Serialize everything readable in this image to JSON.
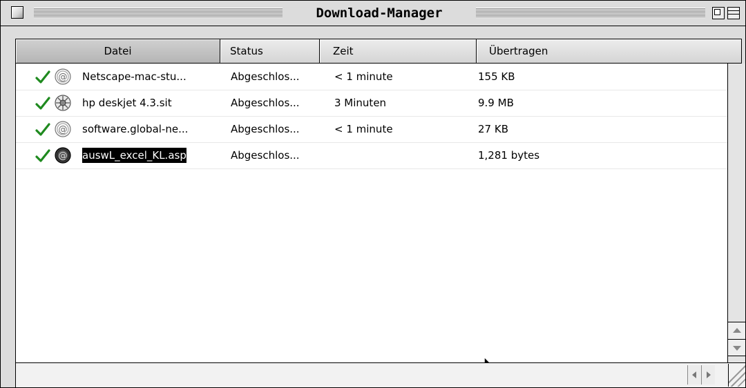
{
  "window": {
    "title": "Download-Manager"
  },
  "columns": {
    "datei": "Datei",
    "status": "Status",
    "zeit": "Zeit",
    "uebertragen": "Übertragen"
  },
  "downloads": [
    {
      "name": "Netscape-mac-stu...",
      "status": "Abgeschlos...",
      "zeit": "< 1 minute",
      "uebertragen": "155 KB",
      "icon": "at-sign-file-icon",
      "state_icon": "checkmark-icon"
    },
    {
      "name": "hp deskjet 4.3.sit",
      "status": "Abgeschlos...",
      "zeit": "3 Minuten",
      "uebertragen": "9.9 MB",
      "icon": "stuffit-archive-icon",
      "state_icon": "checkmark-icon"
    },
    {
      "name": "software.global-ne...",
      "status": "Abgeschlos...",
      "zeit": "< 1 minute",
      "uebertragen": "27 KB",
      "icon": "at-sign-file-icon",
      "state_icon": "checkmark-icon"
    },
    {
      "name": "auswL_excel_KL.asp",
      "status": "Abgeschlos...",
      "zeit": "",
      "uebertragen": "1,281 bytes",
      "icon": "at-sign-file-icon",
      "state_icon": "checkmark-icon",
      "selected": true
    }
  ],
  "colors": {
    "check_green": "#1f8a1f",
    "selection": "#000000",
    "window_bg": "#dddddd"
  }
}
